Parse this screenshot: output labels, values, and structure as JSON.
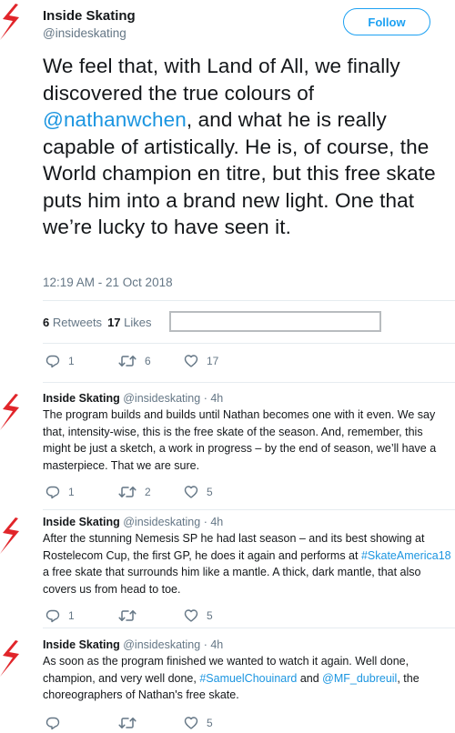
{
  "colors": {
    "accent": "#1da1f2",
    "link": "#1b95e0",
    "muted": "#657786",
    "text": "#14171a",
    "brand_red": "#e1252a"
  },
  "author": {
    "name": "Inside Skating",
    "handle": "@insideskating",
    "avatar_icon": "inside-skating-logo"
  },
  "follow_label": "Follow",
  "tweet": {
    "text_before": "We feel that, with Land of All, we finally discovered the true colours of ",
    "mention": "@nathanwchen",
    "text_after": ", and what he is really capable of artistically. He is, of course, the World champion en titre, but this free skate puts him into a brand new light. One that we’re lucky to have seen it.",
    "timestamp": "12:19 AM - 21 Oct 2018",
    "retweets_count": "6",
    "retweets_label": "Retweets",
    "likes_count": "17",
    "likes_label": "Likes",
    "actions": {
      "replies": "1",
      "retweets": "6",
      "likes": "17"
    }
  },
  "replies": [
    {
      "name": "Inside Skating",
      "handle": "@insideskating",
      "time": "· 4h",
      "segments": [
        {
          "text": "The program builds and builds until Nathan becomes one with it even. We say that, intensity-wise, this is the free skate of the season. And, remember, this might be just a sketch, a work in progress – by the end of season, we’ll have a masterpiece. That we are sure.",
          "link": false
        }
      ],
      "actions": {
        "replies": "1",
        "retweets": "2",
        "likes": "5"
      }
    },
    {
      "name": "Inside Skating",
      "handle": "@insideskating",
      "time": "· 4h",
      "segments": [
        {
          "text": "After the stunning Nemesis SP he had last season – and its best showing at Rostelecom Cup, the first GP, he does it again and performs at ",
          "link": false
        },
        {
          "text": "#SkateAmerica18",
          "link": true
        },
        {
          "text": " a free skate that surrounds him like a mantle. A thick, dark mantle, that also covers us from head to toe.",
          "link": false
        }
      ],
      "actions": {
        "replies": "1",
        "retweets": "",
        "likes": "5"
      }
    },
    {
      "name": "Inside Skating",
      "handle": "@insideskating",
      "time": "· 4h",
      "segments": [
        {
          "text": "As soon as the program finished we wanted to watch it again. Well done, champion, and very well done, ",
          "link": false
        },
        {
          "text": "#SamuelChouinard",
          "link": true
        },
        {
          "text": " and ",
          "link": false
        },
        {
          "text": "@MF_dubreuil",
          "link": true
        },
        {
          "text": ", the choreographers of Nathan's free skate.",
          "link": false
        }
      ],
      "actions": {
        "replies": "",
        "retweets": "",
        "likes": "5"
      }
    }
  ]
}
